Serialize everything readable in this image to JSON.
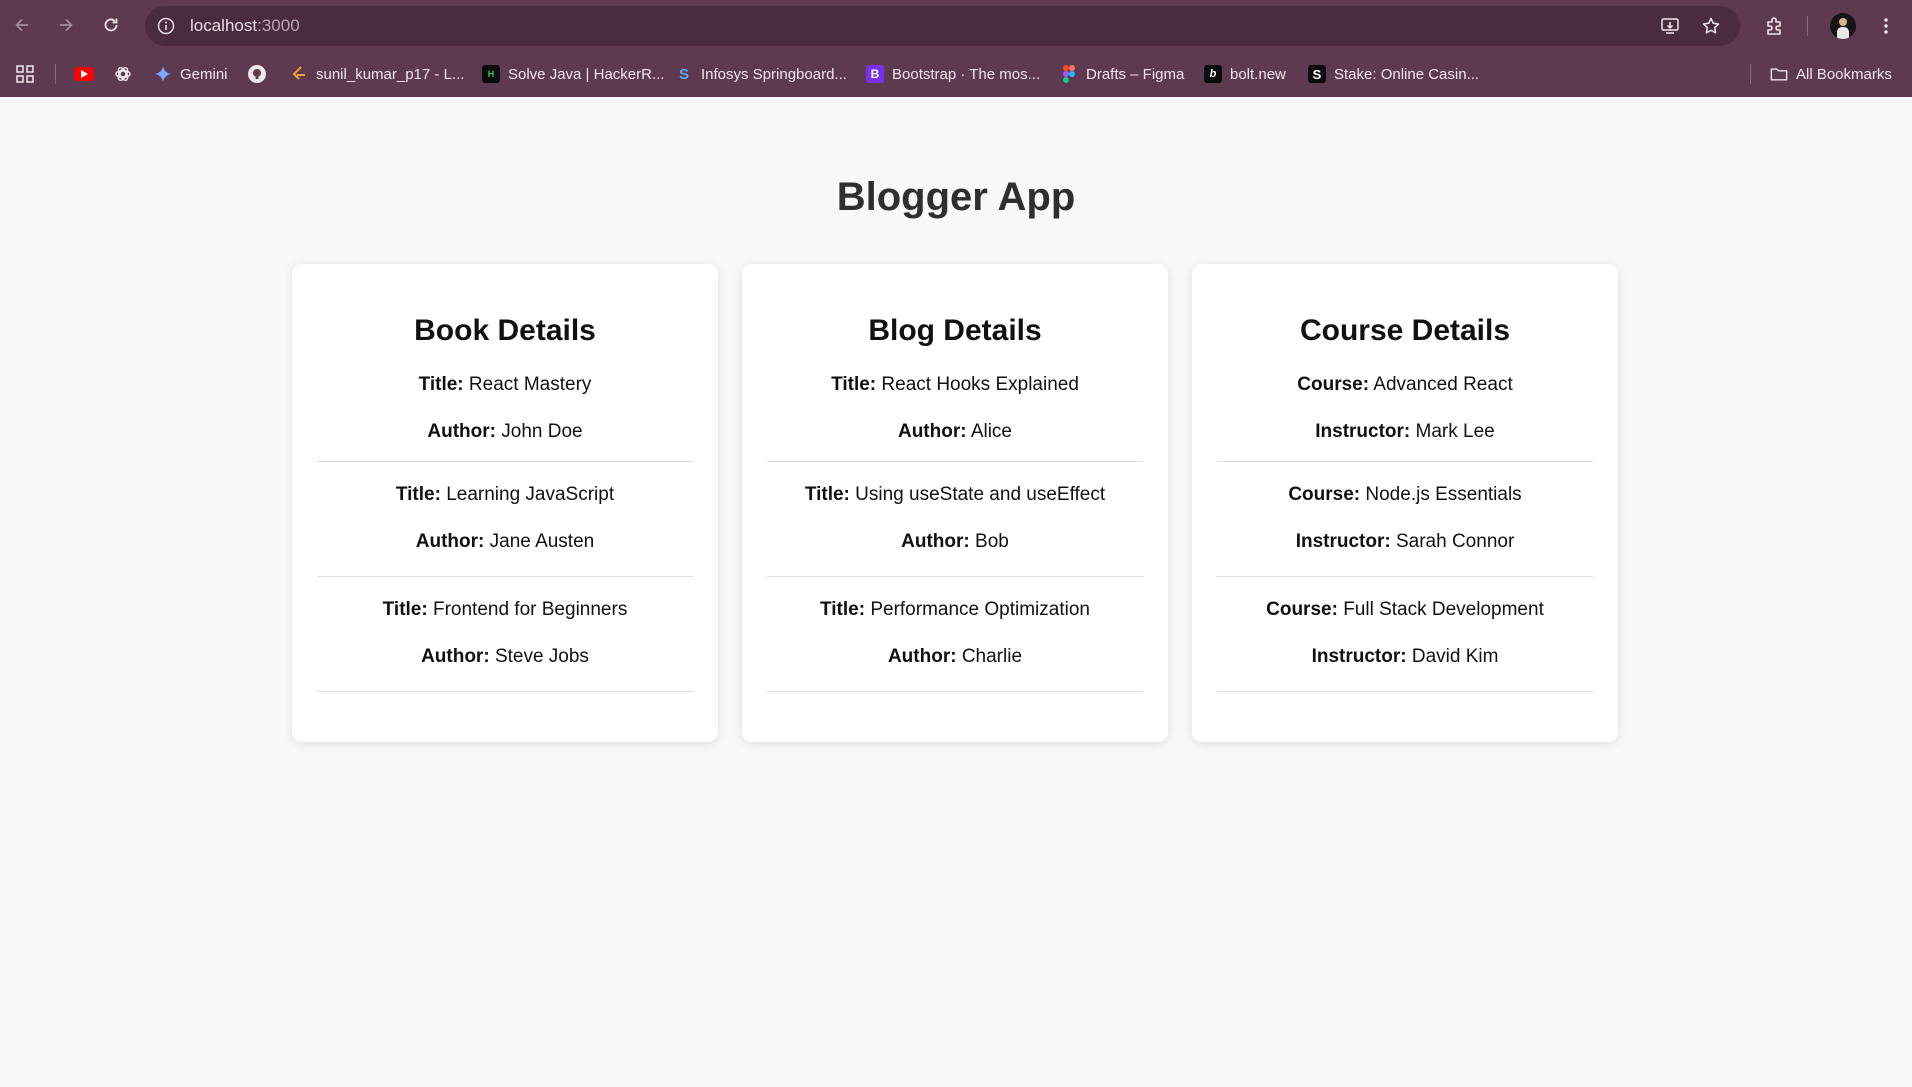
{
  "browser": {
    "url_host": "localhost",
    "url_port": ":3000",
    "bookmarks": [
      {
        "label": "",
        "icon": "youtube-icon"
      },
      {
        "label": "",
        "icon": "chatgpt-icon"
      },
      {
        "label": "Gemini",
        "icon": "gemini-icon"
      },
      {
        "label": "",
        "icon": "github-icon"
      },
      {
        "label": "sunil_kumar_p17 - L...",
        "icon": "leetcode-icon"
      },
      {
        "label": "Solve Java | HackerR...",
        "icon": "hackerrank-icon"
      },
      {
        "label": "Infosys Springboard...",
        "icon": "infosys-icon"
      },
      {
        "label": "Bootstrap · The mos...",
        "icon": "bootstrap-icon"
      },
      {
        "label": "Drafts – Figma",
        "icon": "figma-icon"
      },
      {
        "label": "bolt.new",
        "icon": "bolt-icon"
      },
      {
        "label": "Stake: Online Casin...",
        "icon": "stake-icon"
      }
    ],
    "all_bookmarks": "All Bookmarks"
  },
  "page": {
    "title": "Blogger App",
    "cards": [
      {
        "heading": "Book Details",
        "entries": [
          {
            "k1": "Title:",
            "v1": "React Mastery",
            "k2": "Author:",
            "v2": "John Doe"
          },
          {
            "k1": "Title:",
            "v1": "Learning JavaScript",
            "k2": "Author:",
            "v2": "Jane Austen"
          },
          {
            "k1": "Title:",
            "v1": "Frontend for Beginners",
            "k2": "Author:",
            "v2": "Steve Jobs"
          }
        ]
      },
      {
        "heading": "Blog Details",
        "entries": [
          {
            "k1": "Title:",
            "v1": "React Hooks Explained",
            "k2": "Author:",
            "v2": "Alice"
          },
          {
            "k1": "Title:",
            "v1": "Using useState and useEffect",
            "k2": "Author:",
            "v2": "Bob"
          },
          {
            "k1": "Title:",
            "v1": "Performance Optimization",
            "k2": "Author:",
            "v2": "Charlie"
          }
        ]
      },
      {
        "heading": "Course Details",
        "entries": [
          {
            "k1": "Course:",
            "v1": "Advanced React",
            "k2": "Instructor:",
            "v2": "Mark Lee"
          },
          {
            "k1": "Course:",
            "v1": "Node.js Essentials",
            "k2": "Instructor:",
            "v2": "Sarah Connor"
          },
          {
            "k1": "Course:",
            "v1": "Full Stack Development",
            "k2": "Instructor:",
            "v2": "David Kim"
          }
        ]
      }
    ]
  }
}
